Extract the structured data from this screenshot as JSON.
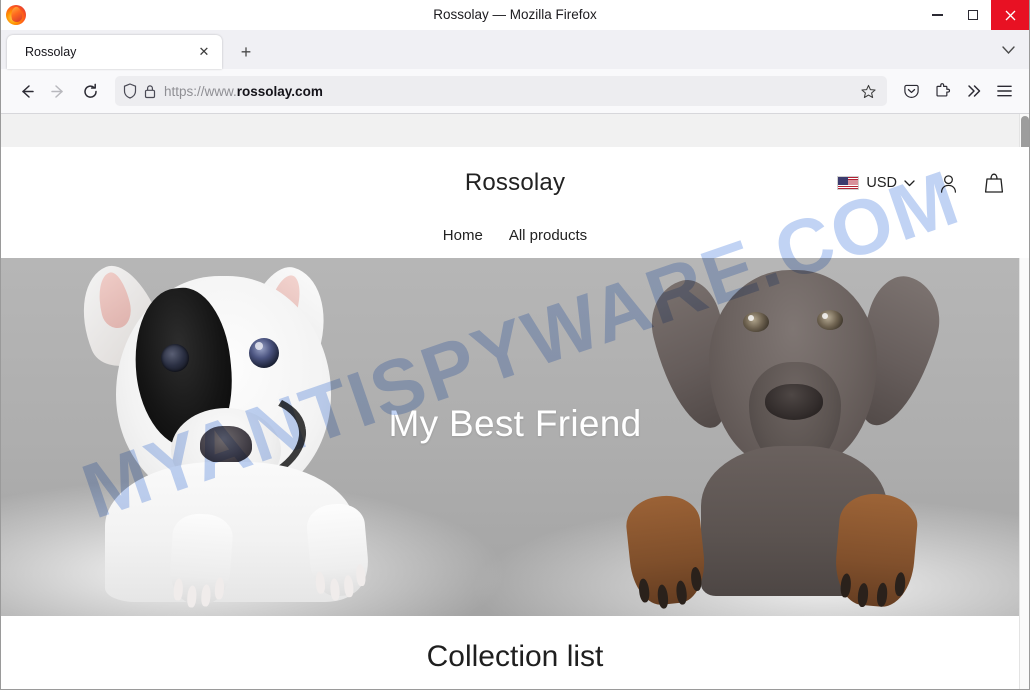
{
  "browser": {
    "window_title": "Rossolay — Mozilla Firefox",
    "firefox_logo_icon": "firefox-logo-icon",
    "minimize_label": "Minimize",
    "maximize_label": "Maximize",
    "close_label": "Close",
    "tab": {
      "title": "Rossolay",
      "close_icon": "✕"
    },
    "new_tab_icon": "+",
    "tab_list_icon": "⌄",
    "toolbar": {
      "back_icon": "←",
      "forward_icon": "→",
      "reload_icon": "⟳",
      "shield_icon": "shield-icon",
      "lock_icon": "lock-icon",
      "url_prefix": "https://www.",
      "url_domain": "rossolay.com",
      "url_full": "https://www.rossolay.com",
      "bookmark_icon": "☆",
      "pocket_icon": "pocket-icon",
      "extensions_icon": "extensions-icon",
      "overflow_icon": "»",
      "menu_icon": "☰"
    }
  },
  "site": {
    "announcement_bar": "",
    "brand": "Rossolay",
    "currency": {
      "flag_icon": "us-flag-icon",
      "code": "USD",
      "chevron_icon": "⌄"
    },
    "account_icon": "account-icon",
    "cart_icon": "cart-icon",
    "nav": [
      {
        "label": "Home"
      },
      {
        "label": "All products"
      }
    ],
    "hero": {
      "title": "My Best Friend",
      "image_alt": "two puppies leaning over a ledge"
    },
    "collections": {
      "title": "Collection list"
    }
  },
  "watermark": {
    "text": "MYANTISPYWARE.COM",
    "color": "#2f6bdb"
  }
}
